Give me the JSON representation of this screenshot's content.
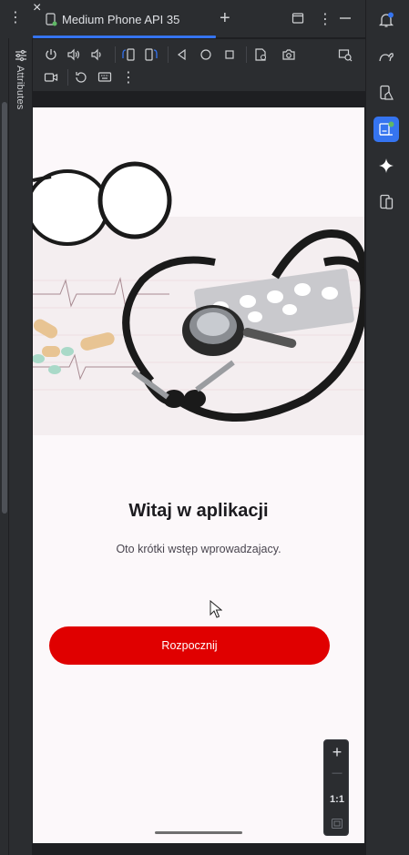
{
  "left": {
    "menu_icon": "more-vertical-icon"
  },
  "attributes_panel": {
    "label": "Attributes",
    "icon": "tune-icon"
  },
  "tab": {
    "title": "Medium Phone API 35",
    "icon": "phone-device-icon",
    "close_glyph": "×",
    "add_glyph": "+"
  },
  "window_controls": [
    "restore-icon",
    "more-vertical-icon",
    "minimize-icon"
  ],
  "toolbar": {
    "row1": [
      "power-icon",
      "volume-up-icon",
      "volume-down-icon",
      "rotate-left-icon",
      "rotate-right-icon",
      "back-icon",
      "home-icon",
      "overview-icon",
      "fold-icon",
      "camera-icon",
      "snapshot-icon"
    ],
    "row2": [
      "record-icon",
      "reset-icon",
      "keyboard-icon",
      "more-vertical-icon"
    ]
  },
  "app": {
    "welcome_title": "Witaj w aplikacji",
    "subtitle": "Oto krótki wstęp wprowadzajacy.",
    "start_button": "Rozpocznij",
    "accent_color": "#e00000",
    "background_color": "#fcf8fa"
  },
  "zoom": {
    "zoom_in": "+",
    "zoom_out": "—",
    "one_to_one": "1:1",
    "fit_icon": "fit-screen-icon"
  },
  "right_strip": [
    "notifications-icon",
    "gradle-icon",
    "device-manager-icon",
    "running-devices-icon",
    "gemini-icon",
    "device-mirroring-icon"
  ]
}
